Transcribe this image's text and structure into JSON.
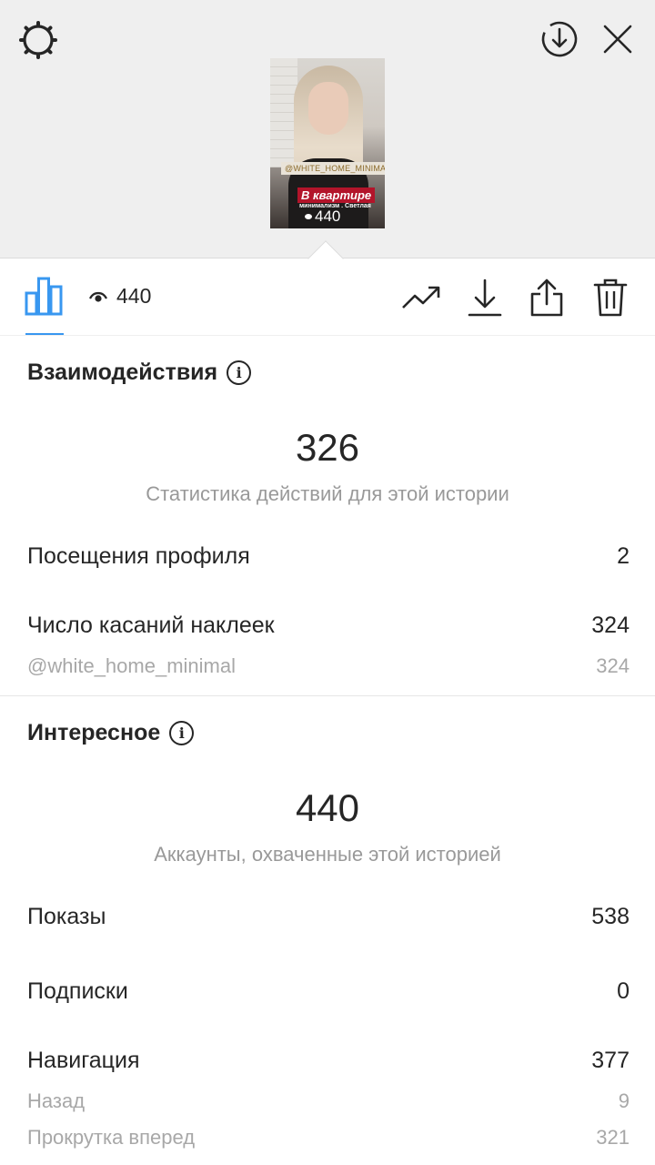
{
  "preview": {
    "sticker_handle": "@WHITE_HOME_MINIMAL",
    "sticker_title": "В квартире",
    "sticker_caption": "минимализм . Светлая",
    "views": "440"
  },
  "toolbar": {
    "view_count": "440",
    "icons": [
      "chart-icon",
      "eye-icon",
      "trend-icon",
      "download-icon",
      "share-icon",
      "trash-icon"
    ]
  },
  "interactions": {
    "title": "Взаимодействия",
    "total": "326",
    "total_label": "Статистика действий для этой истории",
    "rows": [
      {
        "label": "Посещения профиля",
        "value": "2"
      },
      {
        "label": "Число касаний наклеек",
        "value": "324"
      }
    ],
    "sub_rows": [
      {
        "label": "@white_home_minimal",
        "value": "324"
      }
    ]
  },
  "discovery": {
    "title": "Интересное",
    "total": "440",
    "total_label": "Аккаунты, охваченные этой историей",
    "rows": [
      {
        "label": "Показы",
        "value": "538"
      },
      {
        "label": "Подписки",
        "value": "0"
      },
      {
        "label": "Навигация",
        "value": "377"
      }
    ],
    "sub_rows": [
      {
        "label": "Назад",
        "value": "9"
      },
      {
        "label": "Прокрутка вперед",
        "value": "321"
      }
    ]
  },
  "colors": {
    "accent": "#3897f0",
    "text": "#262626",
    "muted": "#999999",
    "header_bg": "#efefef"
  }
}
